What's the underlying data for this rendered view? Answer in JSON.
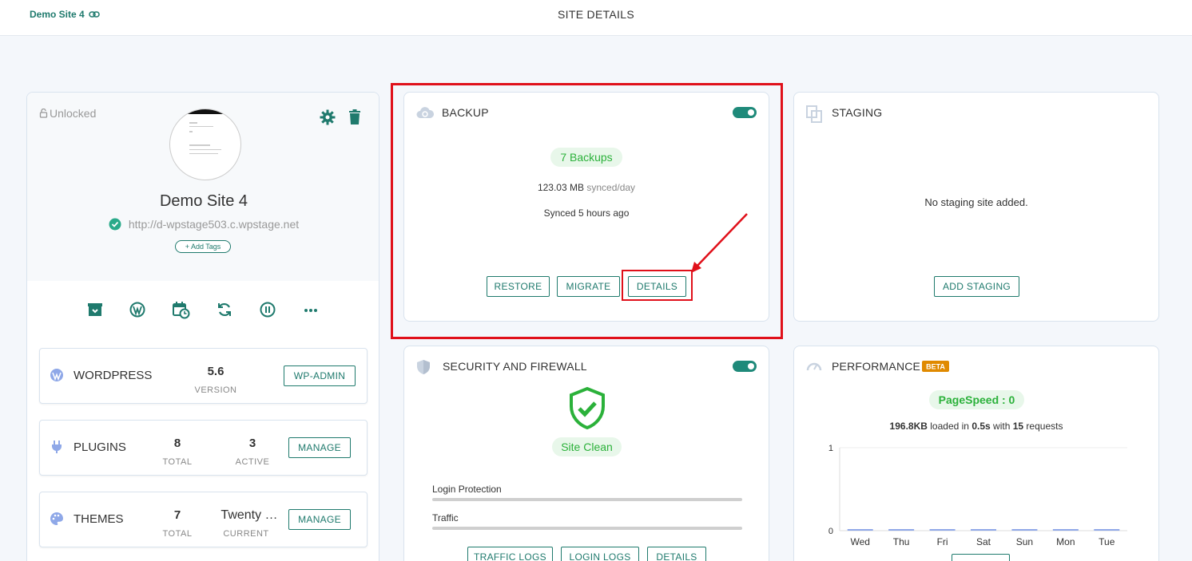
{
  "header": {
    "site_link": "Demo Site 4",
    "page_title": "SITE DETAILS"
  },
  "site": {
    "lock_label": "Unlocked",
    "name": "Demo Site 4",
    "url": "http://d-wpstage503.c.wpstage.net",
    "add_tags": "+ Add Tags",
    "quick_actions": [
      "archive-icon",
      "wordpress-icon",
      "calendar-clock-icon",
      "sync-icon",
      "pause-icon",
      "more-icon"
    ]
  },
  "wordpress": {
    "label": "WORDPRESS",
    "version": "5.6",
    "version_label": "VERSION",
    "button": "WP-ADMIN"
  },
  "plugins": {
    "label": "PLUGINS",
    "total": "8",
    "total_label": "TOTAL",
    "active": "3",
    "active_label": "ACTIVE",
    "button": "MANAGE"
  },
  "themes": {
    "label": "THEMES",
    "total": "7",
    "total_label": "TOTAL",
    "current": "Twenty …",
    "current_label": "CURRENT",
    "button": "MANAGE"
  },
  "backup": {
    "title": "BACKUP",
    "enabled": true,
    "count": "7 Backups",
    "size": "123.03 MB",
    "size_unit": "synced/day",
    "synced": "Synced 5 hours ago",
    "restore": "RESTORE",
    "migrate": "MIGRATE",
    "details": "DETAILS"
  },
  "staging": {
    "title": "STAGING",
    "empty": "No staging site added.",
    "button": "ADD STAGING"
  },
  "security": {
    "title": "SECURITY AND FIREWALL",
    "enabled": true,
    "status": "Site Clean",
    "login_protection": "Login Protection",
    "traffic": "Traffic",
    "traffic_logs": "TRAFFIC LOGS",
    "login_logs": "LOGIN LOGS",
    "details": "DETAILS"
  },
  "performance": {
    "title": "PERFORMANCE",
    "beta": "BETA",
    "pagespeed": "PageSpeed : 0",
    "size": "196.8KB",
    "loaded_in": "loaded in",
    "time": "0.5s",
    "with": "with",
    "requests": "15",
    "requests_label": "requests"
  },
  "chart_data": {
    "type": "bar",
    "categories": [
      "Wed",
      "Thu",
      "Fri",
      "Sat",
      "Sun",
      "Mon",
      "Tue"
    ],
    "values": [
      0,
      0,
      0,
      0,
      0,
      0,
      0
    ],
    "ylim": [
      0,
      1
    ],
    "yticks": [
      "1",
      "0"
    ],
    "bar_color": "#8fa8e8"
  },
  "colors": {
    "accent": "#1f7a6d",
    "success": "#2bb13a",
    "annotation": "#e0101a"
  }
}
